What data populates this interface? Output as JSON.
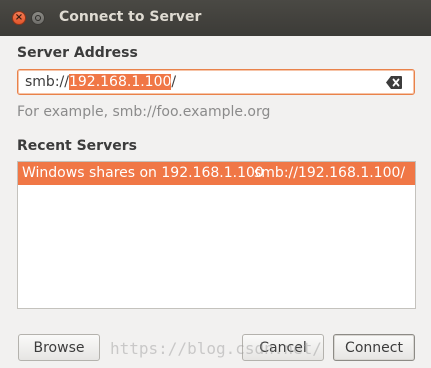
{
  "window": {
    "title": "Connect to Server",
    "close_glyph": "×"
  },
  "server_address": {
    "label": "Server Address",
    "value_prefix": "smb://",
    "value_selected": "192.168.1.100",
    "value_suffix": "/",
    "clear_icon": "backspace-clear-icon",
    "hint": "For example, smb://foo.example.org"
  },
  "recent": {
    "label": "Recent Servers",
    "items": [
      {
        "name": "Windows shares on 192.168.1.100",
        "uri": "smb://192.168.1.100/",
        "selected": true
      }
    ]
  },
  "buttons": {
    "browse": "Browse",
    "cancel": "Cancel",
    "connect": "Connect"
  },
  "watermark": "https://blog.csdn.net/",
  "colors": {
    "accent": "#f07746",
    "titlebar": "#3c3b37"
  }
}
